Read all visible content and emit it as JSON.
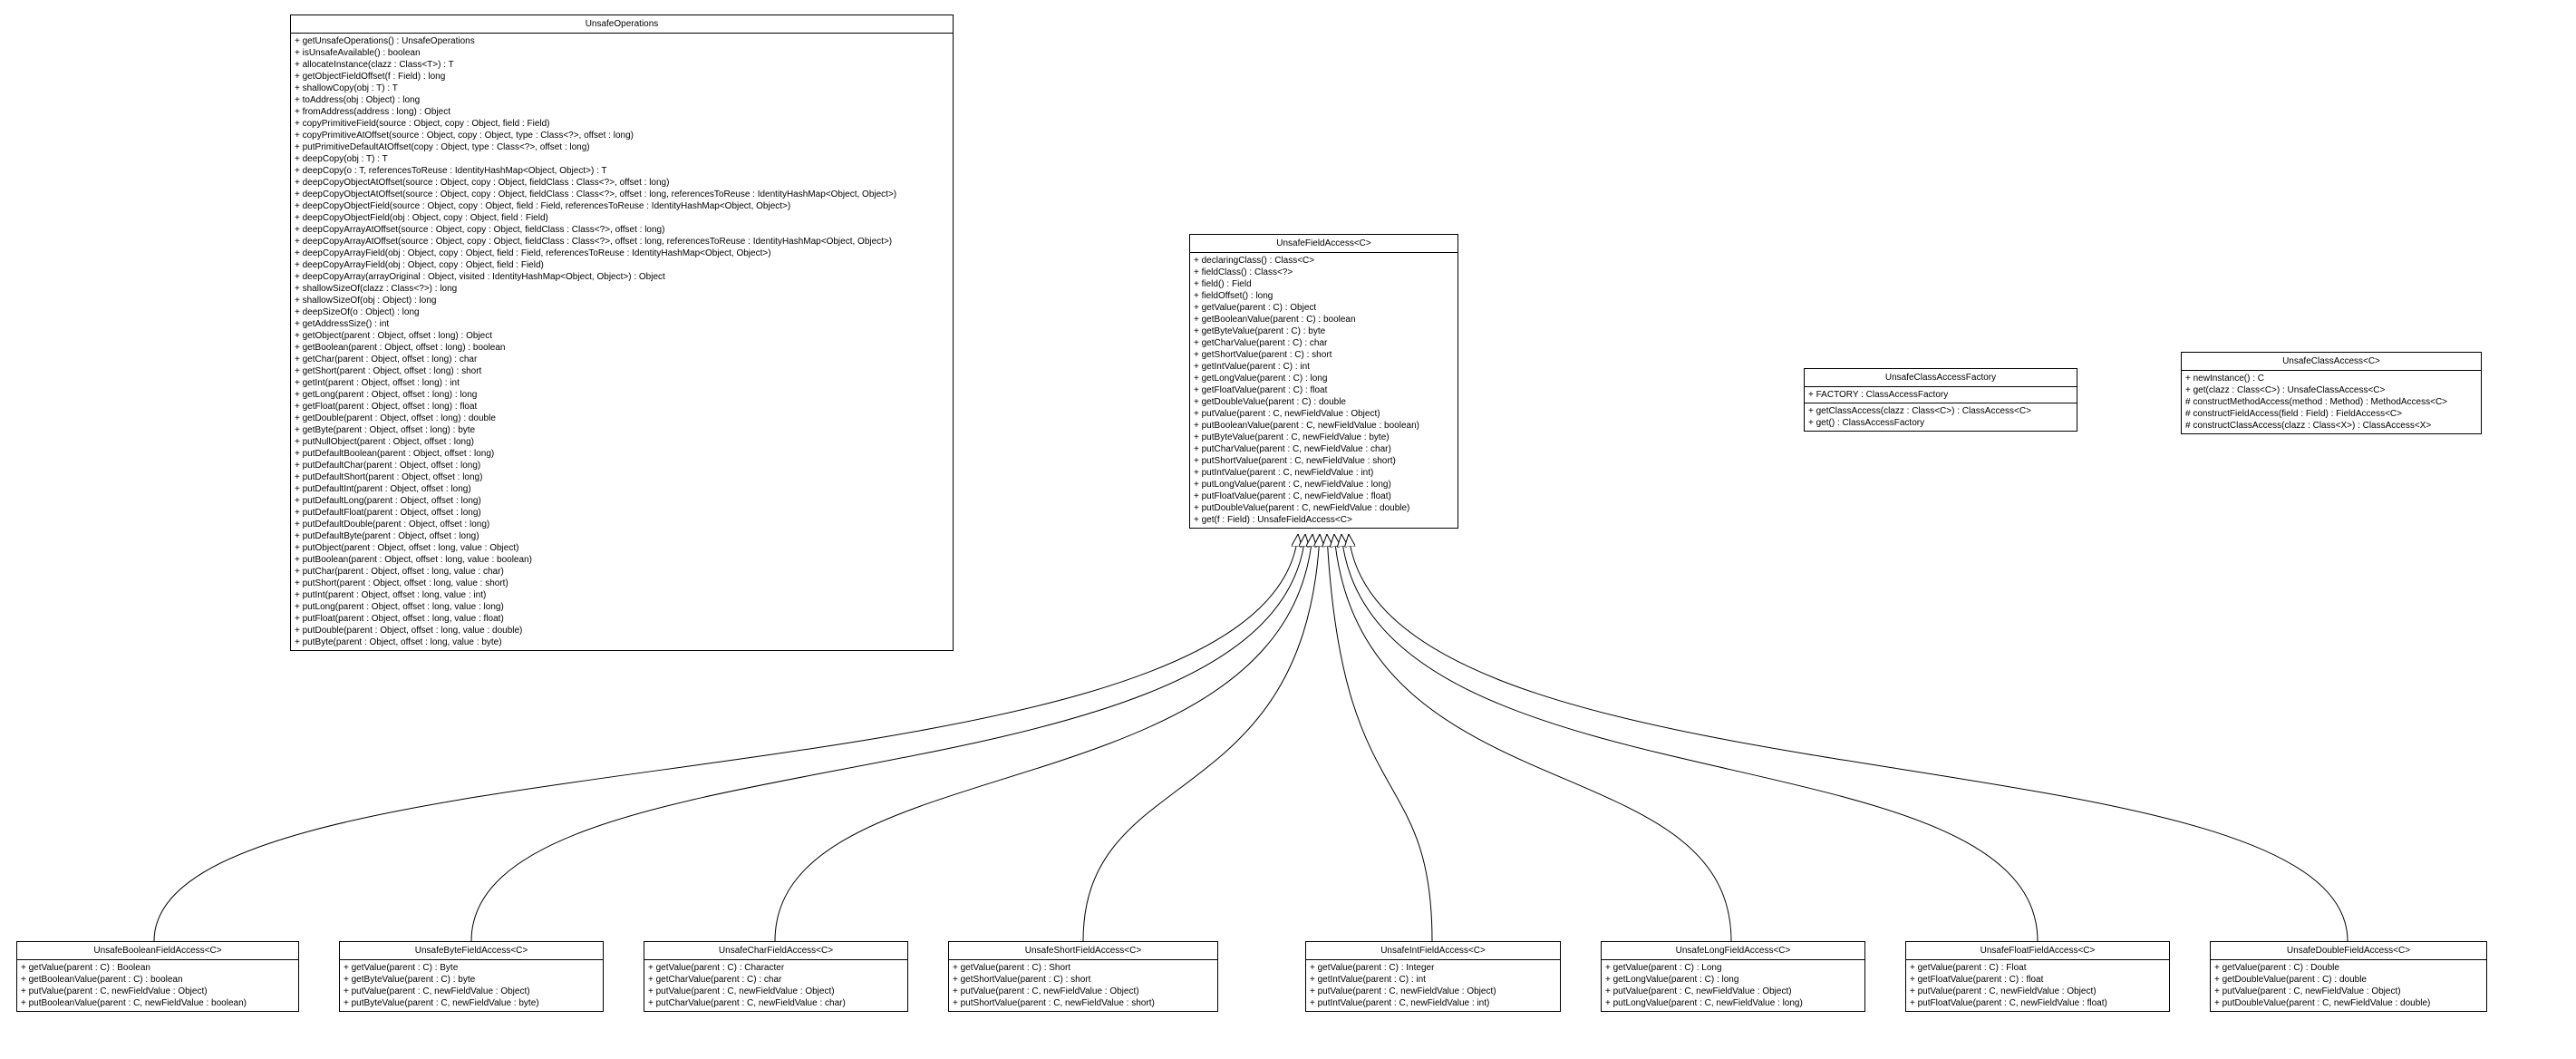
{
  "classes": {
    "unsafeOperations": {
      "name": "UnsafeOperations",
      "methods": [
        "+ getUnsafeOperations() : UnsafeOperations",
        "+ isUnsafeAvailable() : boolean",
        "+ allocateInstance(clazz : Class<T>) : T",
        "+ getObjectFieldOffset(f : Field) : long",
        "+ shallowCopy(obj : T) : T",
        "+ toAddress(obj : Object) : long",
        "+ fromAddress(address : long) : Object",
        "+ copyPrimitiveField(source : Object, copy : Object, field : Field)",
        "+ copyPrimitiveAtOffset(source : Object, copy : Object, type : Class<?>, offset : long)",
        "+ putPrimitiveDefaultAtOffset(copy : Object, type : Class<?>, offset : long)",
        "+ deepCopy(obj : T) : T",
        "+ deepCopy(o : T, referencesToReuse : IdentityHashMap<Object, Object>) : T",
        "+ deepCopyObjectAtOffset(source : Object, copy : Object, fieldClass : Class<?>, offset : long)",
        "+ deepCopyObjectAtOffset(source : Object, copy : Object, fieldClass : Class<?>, offset : long, referencesToReuse : IdentityHashMap<Object, Object>)",
        "+ deepCopyObjectField(source : Object, copy : Object, field : Field, referencesToReuse : IdentityHashMap<Object, Object>)",
        "+ deepCopyObjectField(obj : Object, copy : Object, field : Field)",
        "+ deepCopyArrayAtOffset(source : Object, copy : Object, fieldClass : Class<?>, offset : long)",
        "+ deepCopyArrayAtOffset(source : Object, copy : Object, fieldClass : Class<?>, offset : long, referencesToReuse : IdentityHashMap<Object, Object>)",
        "+ deepCopyArrayField(obj : Object, copy : Object, field : Field, referencesToReuse : IdentityHashMap<Object, Object>)",
        "+ deepCopyArrayField(obj : Object, copy : Object, field : Field)",
        "+ deepCopyArray(arrayOriginal : Object, visited : IdentityHashMap<Object, Object>) : Object",
        "+ shallowSizeOf(clazz : Class<?>) : long",
        "+ shallowSizeOf(obj : Object) : long",
        "+ deepSizeOf(o : Object) : long",
        "+ getAddressSize() : int",
        "+ getObject(parent : Object, offset : long) : Object",
        "+ getBoolean(parent : Object, offset : long) : boolean",
        "+ getChar(parent : Object, offset : long) : char",
        "+ getShort(parent : Object, offset : long) : short",
        "+ getInt(parent : Object, offset : long) : int",
        "+ getLong(parent : Object, offset : long) : long",
        "+ getFloat(parent : Object, offset : long) : float",
        "+ getDouble(parent : Object, offset : long) : double",
        "+ getByte(parent : Object, offset : long) : byte",
        "+ putNullObject(parent : Object, offset : long)",
        "+ putDefaultBoolean(parent : Object, offset : long)",
        "+ putDefaultChar(parent : Object, offset : long)",
        "+ putDefaultShort(parent : Object, offset : long)",
        "+ putDefaultInt(parent : Object, offset : long)",
        "+ putDefaultLong(parent : Object, offset : long)",
        "+ putDefaultFloat(parent : Object, offset : long)",
        "+ putDefaultDouble(parent : Object, offset : long)",
        "+ putDefaultByte(parent : Object, offset : long)",
        "+ putObject(parent : Object, offset : long, value : Object)",
        "+ putBoolean(parent : Object, offset : long, value : boolean)",
        "+ putChar(parent : Object, offset : long, value : char)",
        "+ putShort(parent : Object, offset : long, value : short)",
        "+ putInt(parent : Object, offset : long, value : int)",
        "+ putLong(parent : Object, offset : long, value : long)",
        "+ putFloat(parent : Object, offset : long, value : float)",
        "+ putDouble(parent : Object, offset : long, value : double)",
        "+ putByte(parent : Object, offset : long, value : byte)"
      ]
    },
    "unsafeFieldAccess": {
      "name": "UnsafeFieldAccess<C>",
      "methods": [
        "+ declaringClass() : Class<C>",
        "+ fieldClass() : Class<?>",
        "+ field() : Field",
        "+ fieldOffset() : long",
        "+ getValue(parent : C) : Object",
        "+ getBooleanValue(parent : C) : boolean",
        "+ getByteValue(parent : C) : byte",
        "+ getCharValue(parent : C) : char",
        "+ getShortValue(parent : C) : short",
        "+ getIntValue(parent : C) : int",
        "+ getLongValue(parent : C) : long",
        "+ getFloatValue(parent : C) : float",
        "+ getDoubleValue(parent : C) : double",
        "+ putValue(parent : C, newFieldValue : Object)",
        "+ putBooleanValue(parent : C, newFieldValue : boolean)",
        "+ putByteValue(parent : C, newFieldValue : byte)",
        "+ putCharValue(parent : C, newFieldValue : char)",
        "+ putShortValue(parent : C, newFieldValue : short)",
        "+ putIntValue(parent : C, newFieldValue : int)",
        "+ putLongValue(parent : C, newFieldValue : long)",
        "+ putFloatValue(parent : C, newFieldValue : float)",
        "+ putDoubleValue(parent : C, newFieldValue : double)",
        "+ get(f : Field) : UnsafeFieldAccess<C>"
      ]
    },
    "unsafeClassAccessFactory": {
      "name": "UnsafeClassAccessFactory",
      "attributes": [
        "+ FACTORY : ClassAccessFactory"
      ],
      "methods": [
        "+ getClassAccess(clazz : Class<C>) : ClassAccess<C>",
        "+ get() : ClassAccessFactory"
      ]
    },
    "unsafeClassAccess": {
      "name": "UnsafeClassAccess<C>",
      "methods": [
        "+ newInstance() : C",
        "+ get(clazz : Class<C>) : UnsafeClassAccess<C>",
        "# constructMethodAccess(method : Method) : MethodAccess<C>",
        "# constructFieldAccess(field : Field) : FieldAccess<C>",
        "# constructClassAccess(clazz : Class<X>) : ClassAccess<X>"
      ]
    },
    "unsafeBooleanFieldAccess": {
      "name": "UnsafeBooleanFieldAccess<C>",
      "methods": [
        "+ getValue(parent : C) : Boolean",
        "+ getBooleanValue(parent : C) : boolean",
        "+ putValue(parent : C, newFieldValue : Object)",
        "+ putBooleanValue(parent : C, newFieldValue : boolean)"
      ]
    },
    "unsafeByteFieldAccess": {
      "name": "UnsafeByteFieldAccess<C>",
      "methods": [
        "+ getValue(parent : C) : Byte",
        "+ getByteValue(parent : C) : byte",
        "+ putValue(parent : C, newFieldValue : Object)",
        "+ putByteValue(parent : C, newFieldValue : byte)"
      ]
    },
    "unsafeCharFieldAccess": {
      "name": "UnsafeCharFieldAccess<C>",
      "methods": [
        "+ getValue(parent : C) : Character",
        "+ getCharValue(parent : C) : char",
        "+ putValue(parent : C, newFieldValue : Object)",
        "+ putCharValue(parent : C, newFieldValue : char)"
      ]
    },
    "unsafeShortFieldAccess": {
      "name": "UnsafeShortFieldAccess<C>",
      "methods": [
        "+ getValue(parent : C) : Short",
        "+ getShortValue(parent : C) : short",
        "+ putValue(parent : C, newFieldValue : Object)",
        "+ putShortValue(parent : C, newFieldValue : short)"
      ]
    },
    "unsafeIntFieldAccess": {
      "name": "UnsafeIntFieldAccess<C>",
      "methods": [
        "+ getValue(parent : C) : Integer",
        "+ getIntValue(parent : C) : int",
        "+ putValue(parent : C, newFieldValue : Object)",
        "+ putIntValue(parent : C, newFieldValue : int)"
      ]
    },
    "unsafeLongFieldAccess": {
      "name": "UnsafeLongFieldAccess<C>",
      "methods": [
        "+ getValue(parent : C) : Long",
        "+ getLongValue(parent : C) : long",
        "+ putValue(parent : C, newFieldValue : Object)",
        "+ putLongValue(parent : C, newFieldValue : long)"
      ]
    },
    "unsafeFloatFieldAccess": {
      "name": "UnsafeFloatFieldAccess<C>",
      "methods": [
        "+ getValue(parent : C) : Float",
        "+ getFloatValue(parent : C) : float",
        "+ putValue(parent : C, newFieldValue : Object)",
        "+ putFloatValue(parent : C, newFieldValue : float)"
      ]
    },
    "unsafeDoubleFieldAccess": {
      "name": "UnsafeDoubleFieldAccess<C>",
      "methods": [
        "+ getValue(parent : C) : Double",
        "+ getDoubleValue(parent : C) : double",
        "+ putValue(parent : C, newFieldValue : Object)",
        "+ putDoubleValue(parent : C, newFieldValue : double)"
      ]
    }
  }
}
